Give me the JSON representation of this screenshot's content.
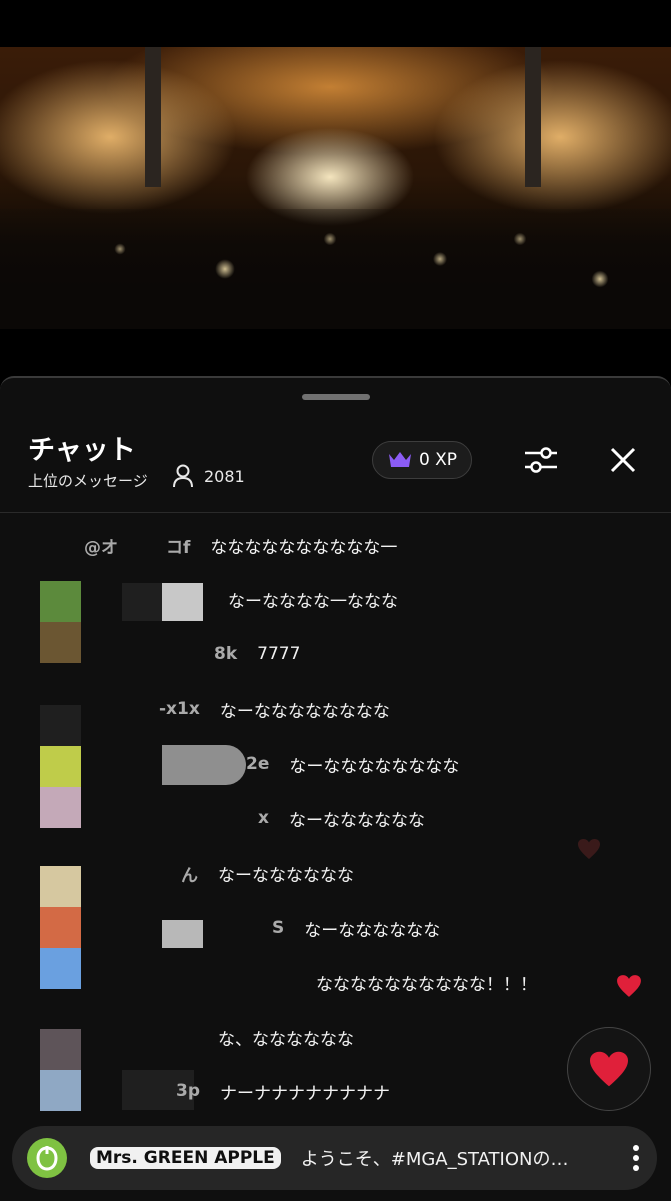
{
  "chat": {
    "title": "チャット",
    "subtitle": "上位のメッセージ",
    "viewer_count": "2081",
    "xp": "0 XP"
  },
  "messages": [
    {
      "author": "@オ",
      "author_suffix": "コf",
      "text": "なななななななななな一"
    },
    {
      "author": "",
      "text": "なーなななな一ななな"
    },
    {
      "author": "8k",
      "text": "7777"
    },
    {
      "author": "-x1x",
      "text": "なーなななななななな"
    },
    {
      "author": "2e",
      "text": "なーなななななななな"
    },
    {
      "author": "x",
      "text": "なーなななななな"
    },
    {
      "author": "ん",
      "text": "なーなななななな"
    },
    {
      "author": "S",
      "text": "なーなななななな"
    },
    {
      "author": "",
      "text": "なななななななななな！！！"
    },
    {
      "author": "",
      "text": "な、なななななな"
    },
    {
      "author": "3p",
      "text": "ナーナナナナナナナナ"
    }
  ],
  "pinned": {
    "badge": "Mrs. GREEN APPLE",
    "text": "ようこそ、#MGA_STATIONの配信へ"
  },
  "colors": {
    "panel_bg": "#0f0f0f",
    "accent_purple": "#8c5cf6",
    "heart_red": "#e0203a",
    "brand_green": "#7fc242"
  },
  "icons": [
    "user-icon",
    "crown-icon",
    "filter-icon",
    "close-icon",
    "heart-icon",
    "more-vert-icon",
    "brand-logo-icon"
  ]
}
